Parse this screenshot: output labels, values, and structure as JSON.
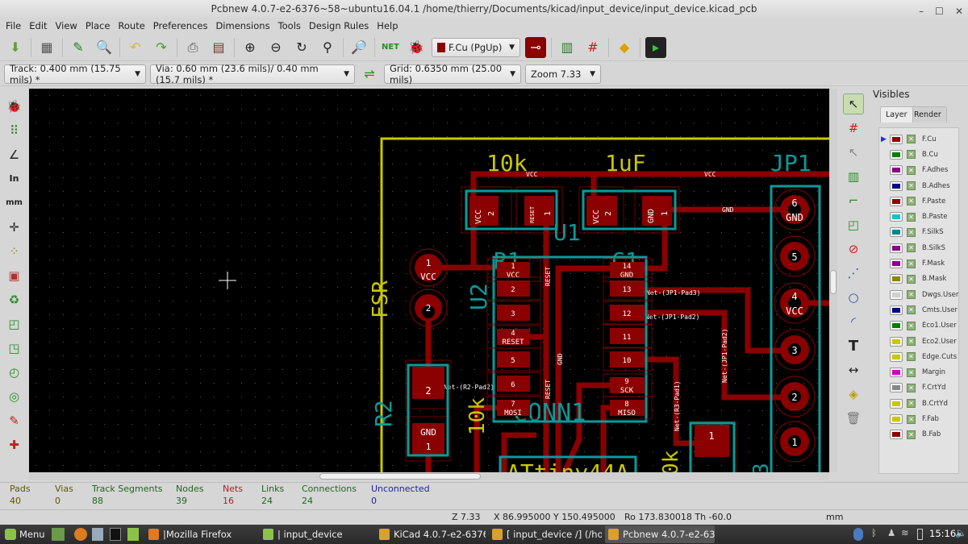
{
  "window": {
    "title": "Pcbnew 4.0.7-e2-6376~58~ubuntu16.04.1 /home/thierry/Documents/kicad/input_device/input_device.kicad_pcb",
    "controls": [
      "–",
      "☐",
      "✕"
    ]
  },
  "menu": [
    "File",
    "Edit",
    "View",
    "Place",
    "Route",
    "Preferences",
    "Dimensions",
    "Tools",
    "Design Rules",
    "Help"
  ],
  "toolbar": {
    "active_layer": "F.Cu (PgUp)",
    "active_layer_color": "#8b0000",
    "track": "Track: 0.400 mm (15.75 mils) *",
    "via": "Via: 0.60 mm (23.6 mils)/ 0.40 mm (15.7 mils) *",
    "grid": "Grid: 0.6350 mm (25.00 mils)",
    "zoom": "Zoom 7.33"
  },
  "visibles": {
    "title": "Visibles",
    "tabs": [
      "Layer",
      "Render"
    ],
    "active_tab": "Layer",
    "layers": [
      {
        "name": "F.Cu",
        "color": "#8b0000",
        "active": true
      },
      {
        "name": "B.Cu",
        "color": "#008000"
      },
      {
        "name": "F.Adhes",
        "color": "#880088"
      },
      {
        "name": "B.Adhes",
        "color": "#000088"
      },
      {
        "name": "F.Paste",
        "color": "#8b0000"
      },
      {
        "name": "B.Paste",
        "color": "#00c8c8"
      },
      {
        "name": "F.SilkS",
        "color": "#008888"
      },
      {
        "name": "B.SilkS",
        "color": "#880088"
      },
      {
        "name": "F.Mask",
        "color": "#880088"
      },
      {
        "name": "B.Mask",
        "color": "#888800"
      },
      {
        "name": "Dwgs.User",
        "color": "#d0d0d0"
      },
      {
        "name": "Cmts.User",
        "color": "#000088"
      },
      {
        "name": "Eco1.User",
        "color": "#008000"
      },
      {
        "name": "Eco2.User",
        "color": "#c8c800"
      },
      {
        "name": "Edge.Cuts",
        "color": "#c8c800"
      },
      {
        "name": "Margin",
        "color": "#c800c8"
      },
      {
        "name": "F.CrtYd",
        "color": "#888888"
      },
      {
        "name": "B.CrtYd",
        "color": "#c8c800"
      },
      {
        "name": "F.Fab",
        "color": "#c8c800"
      },
      {
        "name": "B.Fab",
        "color": "#8b0000"
      }
    ]
  },
  "status": [
    {
      "label": "Pads",
      "value": "40",
      "color": "#5a5a00"
    },
    {
      "label": "Vias",
      "value": "0",
      "color": "#5a5a00"
    },
    {
      "label": "Track Segments",
      "value": "88",
      "color": "#226622"
    },
    {
      "label": "Nodes",
      "value": "39",
      "color": "#226622"
    },
    {
      "label": "Nets",
      "value": "16",
      "color": "#aa2222"
    },
    {
      "label": "Links",
      "value": "24",
      "color": "#226622"
    },
    {
      "label": "Connections",
      "value": "24",
      "color": "#226622"
    },
    {
      "label": "Unconnected",
      "value": "0",
      "color": "#2222aa"
    }
  ],
  "coords": {
    "zoom": "Z 7.33",
    "xy": "X 86.995000  Y 150.495000",
    "polar": "Ro 173.830018  Th -60.0",
    "units": "mm"
  },
  "pcb": {
    "r1_value": "10k",
    "c1_value": "1uF",
    "jp1_ref": "JP1",
    "u1_ref": "U1",
    "r1_ref": "R1",
    "c1_ref": "C1",
    "u2_ref": "U2",
    "fsr": "FSR",
    "r2_ref": "R2",
    "r2_value": "10k",
    "conn1": "CONN1",
    "attiny": "ATtiny44A",
    "partial_value": "0k",
    "partial_ref": "3",
    "net_vcc": "VCC",
    "net_gnd": "GND",
    "net_reset": "RESET",
    "net_jp1_pad3": "Net-(JP1-Pad3)",
    "net_jp1_pad2": "Net-(JP1-Pad2)",
    "net_r3_pad1": "Net-(R3-Pad1)",
    "net_r2_pad2": "Net-(R2-Pad2)",
    "u2_left": [
      {
        "n": "1",
        "s": "VCC"
      },
      {
        "n": "2",
        "s": ""
      },
      {
        "n": "3",
        "s": ""
      },
      {
        "n": "4",
        "s": "RESET"
      },
      {
        "n": "5",
        "s": ""
      },
      {
        "n": "6",
        "s": ""
      },
      {
        "n": "7",
        "s": "MOSI"
      }
    ],
    "u2_right": [
      {
        "n": "14",
        "s": "GND"
      },
      {
        "n": "13",
        "s": ""
      },
      {
        "n": "12",
        "s": ""
      },
      {
        "n": "11",
        "s": ""
      },
      {
        "n": "10",
        "s": ""
      },
      {
        "n": "9",
        "s": "SCK"
      },
      {
        "n": "8",
        "s": "MISO"
      }
    ],
    "jp1_pads": [
      {
        "n": "6",
        "s": "GND"
      },
      {
        "n": "5",
        "s": ""
      },
      {
        "n": "4",
        "s": "VCC"
      },
      {
        "n": "3",
        "s": ""
      },
      {
        "n": "2",
        "s": ""
      },
      {
        "n": "1",
        "s": ""
      }
    ],
    "pad_1": "1",
    "pad_2": "2"
  },
  "taskbar": {
    "menu": "Menu",
    "items": [
      "|Mozilla Firefox",
      "| input_device",
      "KiCad 4.0.7-e2-6376...",
      "[ input_device /] (/ho...",
      "Pcbnew 4.0.7-e2-63..."
    ],
    "active_index": 4,
    "time": "15:16"
  }
}
